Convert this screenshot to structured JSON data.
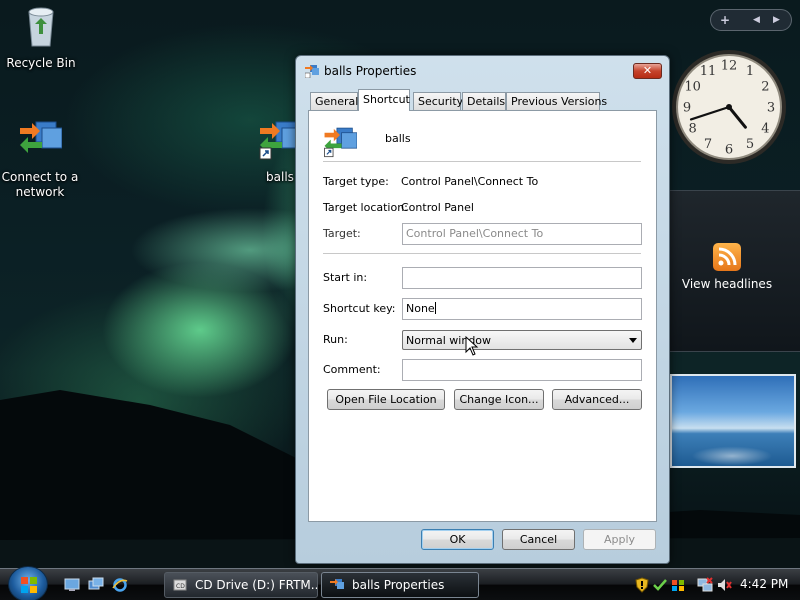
{
  "desktop": {
    "icons": [
      {
        "label": "Recycle Bin"
      },
      {
        "label": "Connect to a network"
      },
      {
        "label": "balls"
      }
    ]
  },
  "sidebar": {
    "add_label": "+",
    "prev_label": "◀",
    "next_label": "▶",
    "feed_label": "View headlines"
  },
  "clock": {
    "hour": 4,
    "minute": 42
  },
  "dialog": {
    "title": "balls Properties",
    "close_label": "✕",
    "tabs": [
      {
        "label": "General"
      },
      {
        "label": "Shortcut"
      },
      {
        "label": "Security"
      },
      {
        "label": "Details"
      },
      {
        "label": "Previous Versions"
      }
    ],
    "shortcut_name": "balls",
    "target_type_label": "Target type:",
    "target_type_value": "Control Panel\\Connect To",
    "target_location_label": "Target location:",
    "target_location_value": "Control Panel",
    "target_label": "Target:",
    "target_value": "Control Panel\\Connect To",
    "start_in_label": "Start in:",
    "start_in_value": "",
    "shortcut_key_label": "Shortcut key:",
    "shortcut_key_value": "None",
    "run_label": "Run:",
    "run_value": "Normal window",
    "comment_label": "Comment:",
    "comment_value": "",
    "open_file_location_label": "Open File Location",
    "change_icon_label": "Change Icon...",
    "advanced_label": "Advanced...",
    "ok_label": "OK",
    "cancel_label": "Cancel",
    "apply_label": "Apply"
  },
  "taskbar": {
    "tasks": [
      {
        "label": "CD Drive (D:) FRTM..."
      },
      {
        "label": "balls Properties"
      }
    ],
    "time": "4:42 PM"
  },
  "colors": {
    "accent": "#3c7fb1",
    "close": "#c5432c"
  }
}
